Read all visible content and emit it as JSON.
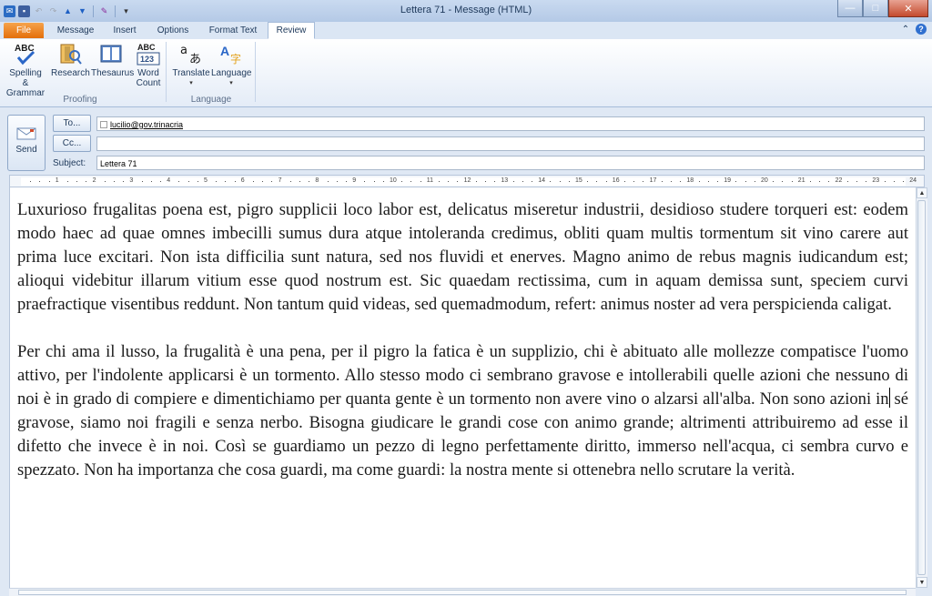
{
  "window": {
    "title": "Lettera 71 - Message (HTML)",
    "controls": {
      "minimize": "—",
      "maximize": "□",
      "close": "✕"
    }
  },
  "qat": {
    "icons": [
      "outlook-icon",
      "save-icon",
      "undo-icon",
      "redo-icon",
      "up-arrow-icon",
      "down-arrow-icon",
      "format-icon",
      "customize-icon"
    ]
  },
  "tabs": [
    {
      "label": "File"
    },
    {
      "label": "Message"
    },
    {
      "label": "Insert"
    },
    {
      "label": "Options"
    },
    {
      "label": "Format Text"
    },
    {
      "label": "Review",
      "active": true
    }
  ],
  "ribbon": {
    "proofing": {
      "label": "Proofing",
      "spelling": {
        "line1": "Spelling &",
        "line2": "Grammar"
      },
      "research": "Research",
      "thesaurus": "Thesaurus",
      "wordcount": {
        "line1": "Word",
        "line2": "Count"
      }
    },
    "language": {
      "label": "Language",
      "translate": "Translate",
      "language": "Language"
    }
  },
  "compose": {
    "send": "Send",
    "to_button": "To...",
    "cc_button": "Cc...",
    "subject_label": "Subject:",
    "to_value": "lucilio@gov.trinacria",
    "cc_value": "",
    "subject_value": "Lettera 71"
  },
  "ruler": {
    "ticks": [
      "1",
      "2",
      "3",
      "4",
      "5",
      "6",
      "7",
      "8",
      "9",
      "10",
      "11",
      "12",
      "13",
      "14",
      "15",
      "16",
      "17",
      "18",
      "19",
      "20",
      "21",
      "22",
      "23",
      "24"
    ]
  },
  "body": {
    "paragraph1": "Luxurioso frugalitas poena est, pigro supplicii loco labor est, delicatus miseretur industrii, desidioso studere torqueri est: eodem modo haec ad quae omnes imbecilli sumus dura atque intoleranda credimus, obliti quam multis tormentum sit vino carere aut prima luce excitari. Non ista difficilia sunt natura, sed nos fluvidi et enerves. Magno animo de rebus magnis iudicandum est; alioqui videbitur illarum vitium esse quod nostrum est. Sic quaedam rectissima, cum in aquam demissa sunt, speciem curvi praefractique visentibus reddunt. Non tantum quid videas, sed quemadmodum, refert: animus noster ad vera perspicienda caligat.",
    "paragraph2_a": "Per chi ama il lusso, la frugalità è una pena, per il pigro la fatica è un supplizio, chi è abituato alle mollezze compatisce l'uomo attivo, per l'indolente applicarsi è un tormento. Allo stesso modo ci sembrano gravose e intollerabili quelle azioni che nessuno di noi è in grado di compiere e dimentichiamo per quanta gente è un tormento non avere vino o alzarsi all'alba. Non sono azioni in",
    "paragraph2_b": " sé gravose, siamo noi fragili e senza nerbo. Bisogna giudicare le grandi cose con animo grande; altrimenti attribuiremo ad esse il difetto che invece è in noi. Così se guardiamo un pezzo di legno perfettamente diritto, immerso nell'acqua, ci sembra curvo e spezzato. Non ha importanza che cosa guardi, ma come guardi: la nostra mente si ottenebra nello scrutare la verità."
  }
}
